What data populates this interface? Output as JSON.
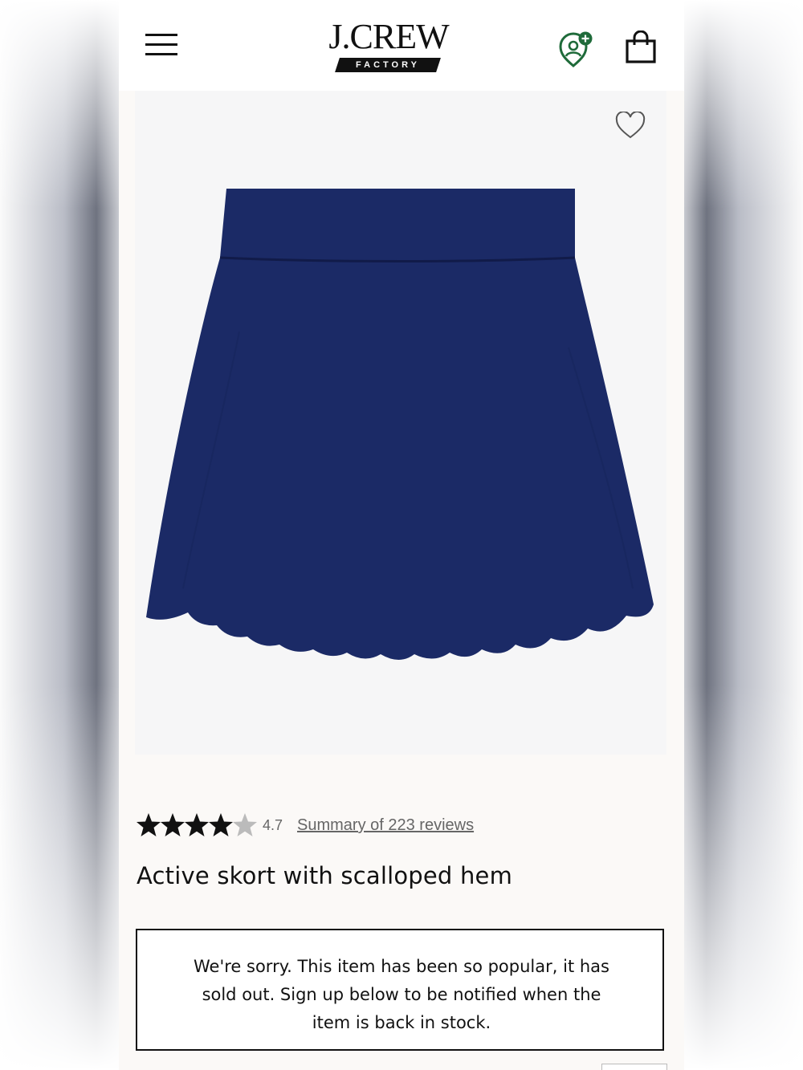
{
  "header": {
    "logo_name": "J.CREW",
    "logo_sub": "FACTORY",
    "menu_icon": "hamburger-menu-icon",
    "account_icon": "account-rewards-icon",
    "bag_icon": "shopping-bag-icon",
    "accent_color": "#1f6b3a"
  },
  "product": {
    "image_icon": "product-skirt-image",
    "wishlist_icon": "heart-outline-icon",
    "skirt_color": "#1b2a66",
    "rating_value": "4.7",
    "rating_stars": 4.7,
    "reviews_link": "Summary of 223 reviews",
    "title": "Active skort with scalloped hem"
  },
  "notice": {
    "message": "We're sorry. This item has been so popular, it has sold out. Sign up below to be notified when the item is back in stock."
  }
}
